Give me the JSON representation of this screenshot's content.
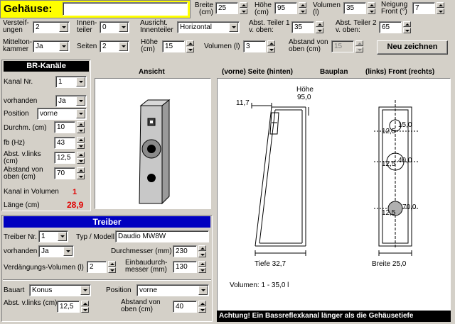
{
  "header": {
    "title": "Gehäuse:",
    "name_value": "",
    "breite": {
      "label": "Breite (cm)",
      "value": "25"
    },
    "hoehe": {
      "label": "Höhe (cm)",
      "value": "95"
    },
    "volumen": {
      "label": "Volumen (l)",
      "value": "35"
    },
    "neigung": {
      "label": "Neigung Front (°)",
      "value": "7"
    }
  },
  "row2": {
    "versteifungen": {
      "label": "Versteif-ungen",
      "value": "2"
    },
    "innenteiler": {
      "label": "Innen-teiler",
      "value": "0"
    },
    "ausricht": {
      "label": "Ausricht. Innenteiler",
      "value": "Horizontal"
    },
    "teiler1": {
      "label": "Abst. Teiler 1 v. oben:",
      "value": "35"
    },
    "teiler2": {
      "label": "Abst. Teiler 2 v. oben:",
      "value": "65"
    }
  },
  "row3": {
    "mittelton": {
      "label": "Mittelton-kammer",
      "value": "Ja"
    },
    "seiten": {
      "label": "Seiten",
      "value": "2"
    },
    "hoehe": {
      "label": "Höhe (cm)",
      "value": "15"
    },
    "volumen": {
      "label": "Volumen (l)",
      "value": "3"
    },
    "abstand": {
      "label": "Abstand von oben (cm)",
      "value": "15"
    },
    "redraw": "Neu zeichnen"
  },
  "br": {
    "title": "BR-Kanäle",
    "kanal_nr": {
      "label": "Kanal Nr.",
      "value": "1"
    },
    "vorhanden": {
      "label": "vorhanden",
      "value": "Ja"
    },
    "position": {
      "label": "Position",
      "value": "vorne"
    },
    "durchm": {
      "label": "Durchm. (cm)",
      "value": "10"
    },
    "fb": {
      "label": "fb (Hz)",
      "value": "43"
    },
    "abst_links": {
      "label": "Abst. v.links (cm)",
      "value": "12,5"
    },
    "abst_oben": {
      "label": "Abstand von oben (cm)",
      "value": "70"
    },
    "kanal_in_vol": {
      "label": "Kanal in Volumen",
      "value": "1"
    },
    "laenge": {
      "label": "Länge (cm)",
      "value": "28,9"
    }
  },
  "views": {
    "ansicht": "Ansicht",
    "seite": "(vorne) Seite (hinten)",
    "bauplan": "Bauplan",
    "front": "(links) Front (rechts)"
  },
  "plan": {
    "hoehe_label": "Höhe",
    "hoehe_value": "95,0",
    "top_dim": "11,7",
    "tiefe": "Tiefe 32,7",
    "breite": "Breite 25,0",
    "m1_left": "12,5",
    "m1_right": "15,0",
    "m2_left": "12,5",
    "m2_right": "40,0",
    "m3_left": "12,5",
    "m3_right": "70,0",
    "volumen": "Volumen:   1 - 35,0  l",
    "warning": "Achtung! Ein Bassreflexkanal länger als die Gehäusetiefe"
  },
  "treiber": {
    "title": "Treiber",
    "nr": {
      "label": "Treiber Nr.",
      "value": "1"
    },
    "modell": {
      "label": "Typ / Modell",
      "value": "Daudio MW8W"
    },
    "vorhanden": {
      "label": "vorhanden",
      "value": "Ja"
    },
    "durchmesser": {
      "label": "Durchmesser (mm)",
      "value": "230"
    },
    "verdraengung": {
      "label": "Verdängungs-Volumen (l)",
      "value": "2"
    },
    "einbau": {
      "label": "Einbaudurch-messer (mm)",
      "value": "130"
    },
    "bauart": {
      "label": "Bauart",
      "value": "Konus"
    },
    "position": {
      "label": "Position",
      "value": "vorne"
    },
    "abst_links": {
      "label": "Abst. v.links (cm)",
      "value": "12,5"
    },
    "abst_oben": {
      "label": "Abstand von oben (cm)",
      "value": "40"
    }
  },
  "colors": {
    "title_bg": "#ffff00",
    "br_header": "#000000",
    "treiber_header": "#0000c0",
    "red": "#e00000"
  }
}
